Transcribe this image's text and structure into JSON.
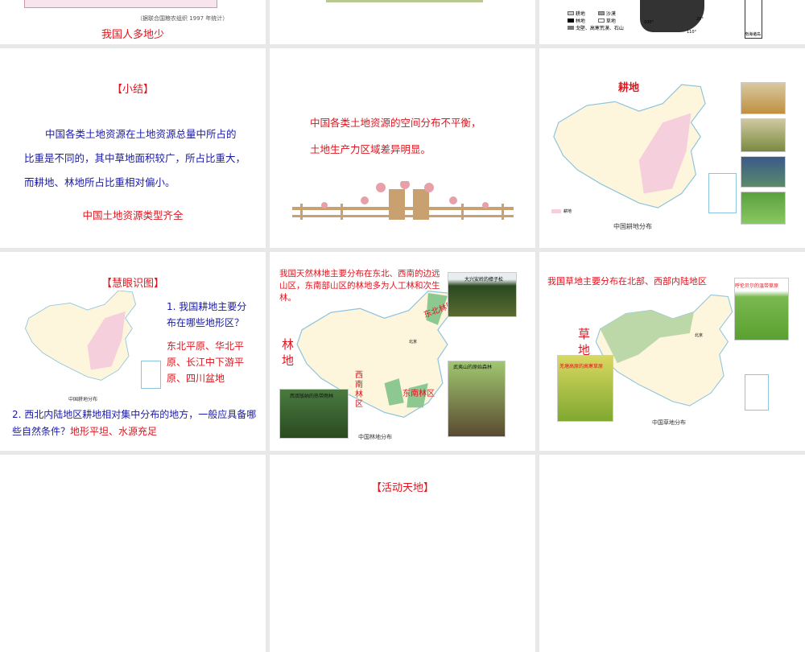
{
  "slides": [
    {
      "source_note": "（据联合国粮农组织 1997 年统计）",
      "caption": "我国人多地少"
    },
    {},
    {
      "legend": [
        "耕地",
        "沙漠",
        "林地",
        "草地",
        "戈壁、高寒荒漠、石山"
      ],
      "lon": [
        "100°",
        "110°"
      ],
      "lat": "20°",
      "inset": "南海诸岛"
    },
    {
      "title": "【小结】",
      "body": "中国各类土地资源在土地资源总量中所占的比重是不同的，其中草地面积较广，所占比重大，而耕地、林地所占比重相对偏小。",
      "conclusion": "中国土地资源类型齐全"
    },
    {
      "text_line1": "中国各类土地资源的空间分布不平衡，",
      "text_line2": "土地生产力区域差异明显。"
    },
    {
      "title": "耕地",
      "map_caption": "中国耕地分布",
      "legend": "耕地"
    },
    {
      "title": "【慧眼识图】",
      "q1": "1. 我国耕地主要分布在哪些地形区？",
      "a1": "东北平原、华北平原、长江中下游平原、四川盆地",
      "q2": "2. 西北内陆地区耕地相对集中分布的地方，一般应具备哪些自然条件？",
      "a2": "地形平坦、水源充足",
      "map_caption": "中国耕地分布"
    },
    {
      "intro": "我国天然林地主要分布在东北、西南的边远山区，东南部山区的林地多为人工林和次生林。",
      "title": "林地",
      "regions": [
        "东北林区",
        "西南林区",
        "东南林区"
      ],
      "photos": [
        "大兴安岭的樟子松",
        "西双版纳的热带雨林",
        "武夷山的原始森林"
      ],
      "map_caption": "中国林地分布",
      "capital": "北京"
    },
    {
      "intro": "我国草地主要分布在北部、西部内陆地区",
      "title": "草地",
      "photos": [
        "呼伦贝尔的温带草原",
        "羌塘高原的高寒草原"
      ],
      "map_caption": "中国草地分布",
      "capital": "北京"
    },
    {},
    {
      "title": "【活动天地】"
    },
    {}
  ],
  "colors": {
    "red": "#e0141e",
    "blue": "#1a1aa8",
    "bg": "#e8e8e8"
  }
}
